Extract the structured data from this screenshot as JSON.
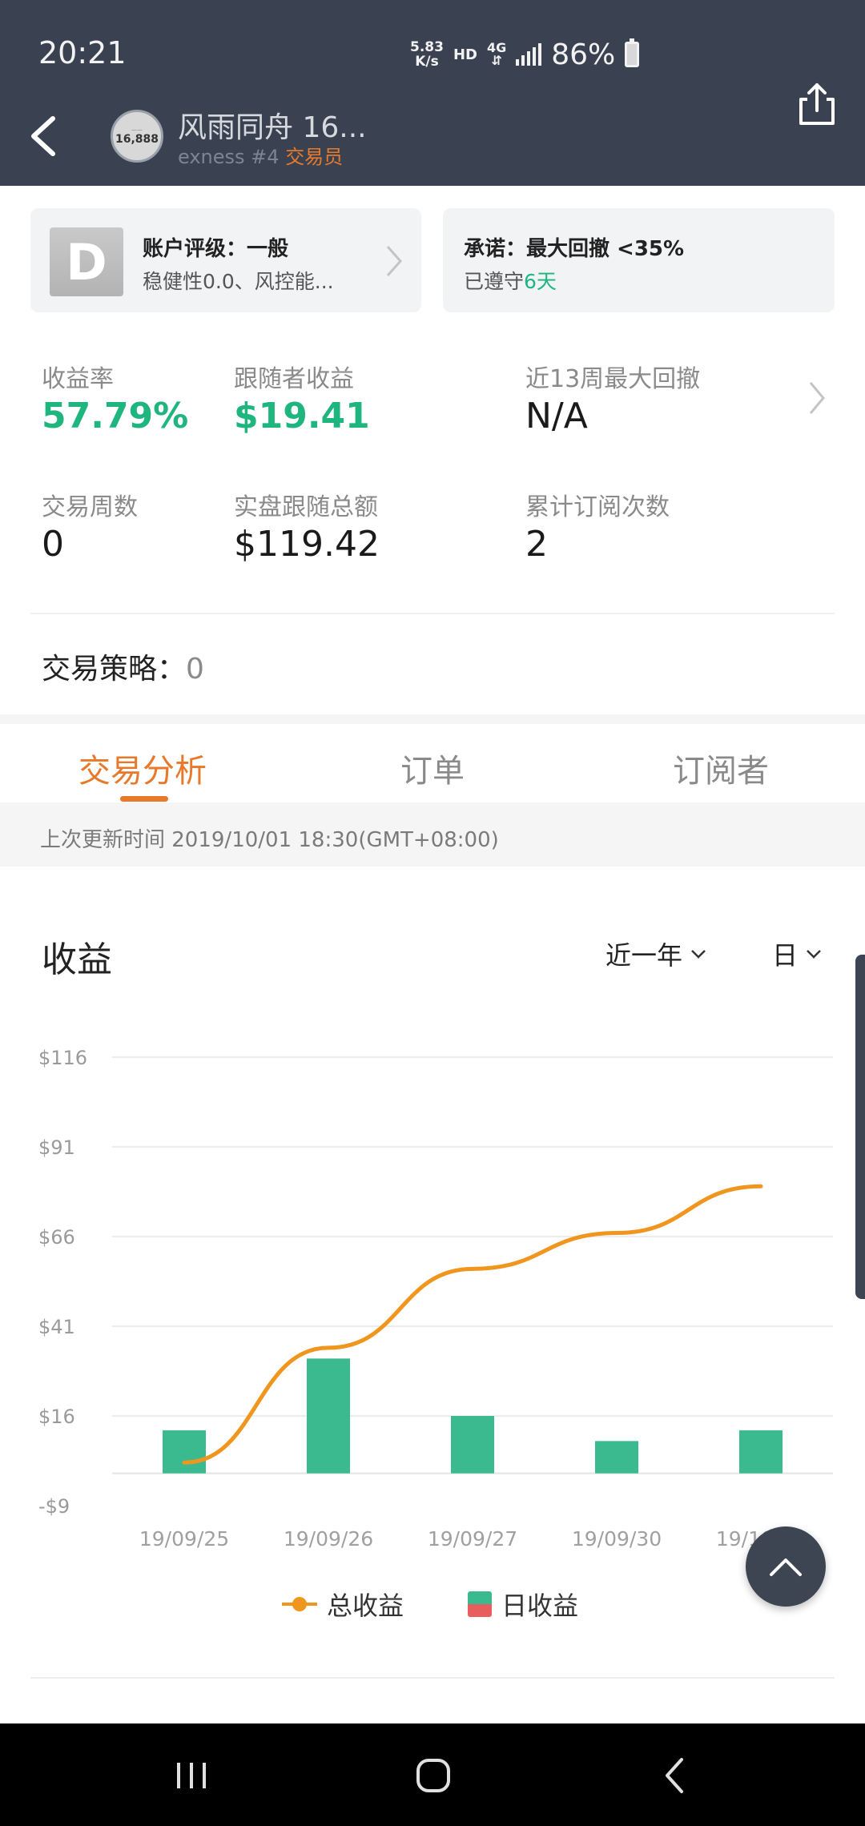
{
  "status_bar": {
    "time": "20:21",
    "net_speed_value": "5.83",
    "net_speed_unit": "K/s",
    "hd": "HD",
    "network": "4G",
    "battery": "86%"
  },
  "header": {
    "avatar_number": "16,888",
    "title": "风雨同舟 16...",
    "subtitle": "exness #4",
    "role": "交易员"
  },
  "cards": {
    "grade_badge": "D",
    "rating_title": "账户评级：一般",
    "rating_sub": "稳健性0.0、风控能...",
    "promise_title": "承诺：最大回撤 <35%",
    "promise_sub_prefix": "已遵守",
    "promise_days": "6天"
  },
  "stats": {
    "return_rate_label": "收益率",
    "return_rate_value": "57.79%",
    "follower_profit_label": "跟随者收益",
    "follower_profit_value": "$19.41",
    "max_drawdown_label": "近13周最大回撤",
    "max_drawdown_value": "N/A",
    "trade_weeks_label": "交易周数",
    "trade_weeks_value": "0",
    "follow_total_label": "实盘跟随总额",
    "follow_total_value": "$119.42",
    "subscriptions_label": "累计订阅次数",
    "subscriptions_value": "2"
  },
  "strategy": {
    "label": "交易策略：",
    "value": "0"
  },
  "tabs": [
    {
      "label": "交易分析",
      "active": true
    },
    {
      "label": "订单",
      "active": false
    },
    {
      "label": "订阅者",
      "active": false
    }
  ],
  "update_text": "上次更新时间 2019/10/01 18:30(GMT+08:00)",
  "chart_section": {
    "title": "收益",
    "range": "近一年",
    "period": "日"
  },
  "chart_data": {
    "type": "bar",
    "categories": [
      "19/09/25",
      "19/09/26",
      "19/09/27",
      "19/09/30",
      "19/10/01"
    ],
    "y_ticks": [
      "$116",
      "$91",
      "$66",
      "$41",
      "$16",
      "-$9"
    ],
    "y_tick_values": [
      116,
      91,
      66,
      41,
      16,
      -9
    ],
    "ylim": [
      -9,
      116
    ],
    "series": [
      {
        "name": "总收益",
        "type": "line",
        "color": "#f0961e",
        "values": [
          3,
          35,
          57,
          67,
          80
        ]
      },
      {
        "name": "日收益",
        "type": "bar",
        "color": "#3bba8f",
        "values": [
          12,
          32,
          16,
          9,
          12
        ]
      }
    ],
    "negative_color": "#e85d5d",
    "grid": true
  },
  "colors": {
    "accent": "#e8792b",
    "positive": "#1fb57f",
    "header_bg": "#3a4252"
  }
}
